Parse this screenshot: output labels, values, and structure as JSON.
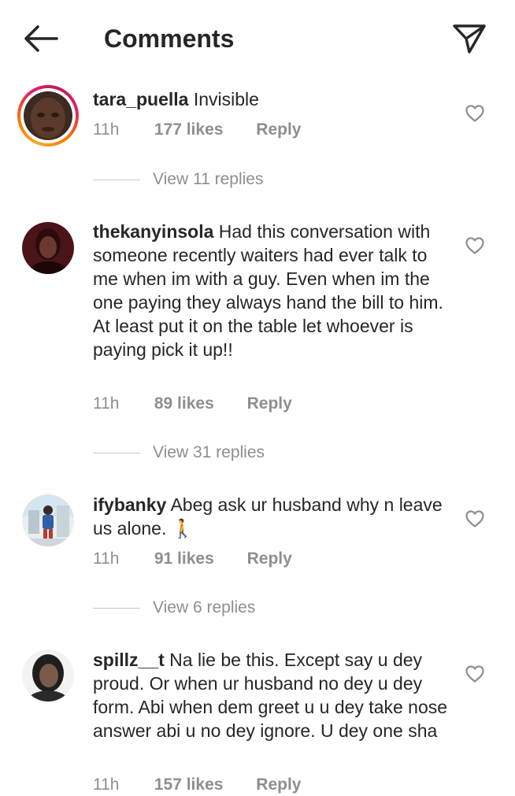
{
  "header": {
    "title": "Comments"
  },
  "comments": [
    {
      "username": "tara_puella",
      "text": "Invisible",
      "time": "11h",
      "likes": "177 likes",
      "reply": "Reply",
      "view_replies": "View 11 replies",
      "has_story_ring": true
    },
    {
      "username": "thekanyinsola",
      "text": "Had this conversation with someone recently waiters had ever talk to me when im with a guy. Even when im the one paying they always hand the bill to him. At least put it on the table let whoever is paying pick it up!!",
      "time": "11h",
      "likes": "89 likes",
      "reply": "Reply",
      "view_replies": "View 31 replies"
    },
    {
      "username": "ifybanky",
      "text": "Abeg ask ur husband why n leave us alone. 🚶",
      "time": "11h",
      "likes": "91 likes",
      "reply": "Reply",
      "view_replies": "View 6 replies"
    },
    {
      "username": "spillz__t",
      "text": "Na lie be this. Except  say u dey proud. Or when ur husband no dey u dey form. Abi when dem greet u u dey take nose answer abi u no dey ignore. U dey one sha",
      "time": "11h",
      "likes": "157 likes",
      "reply": "Reply"
    }
  ],
  "icons": {
    "back": "arrow-left-icon",
    "share": "paper-plane-icon",
    "like": "heart-outline-icon"
  },
  "colors": {
    "text": "#262626",
    "secondary": "#8e8e8e",
    "divider": "#c7c7c7"
  }
}
